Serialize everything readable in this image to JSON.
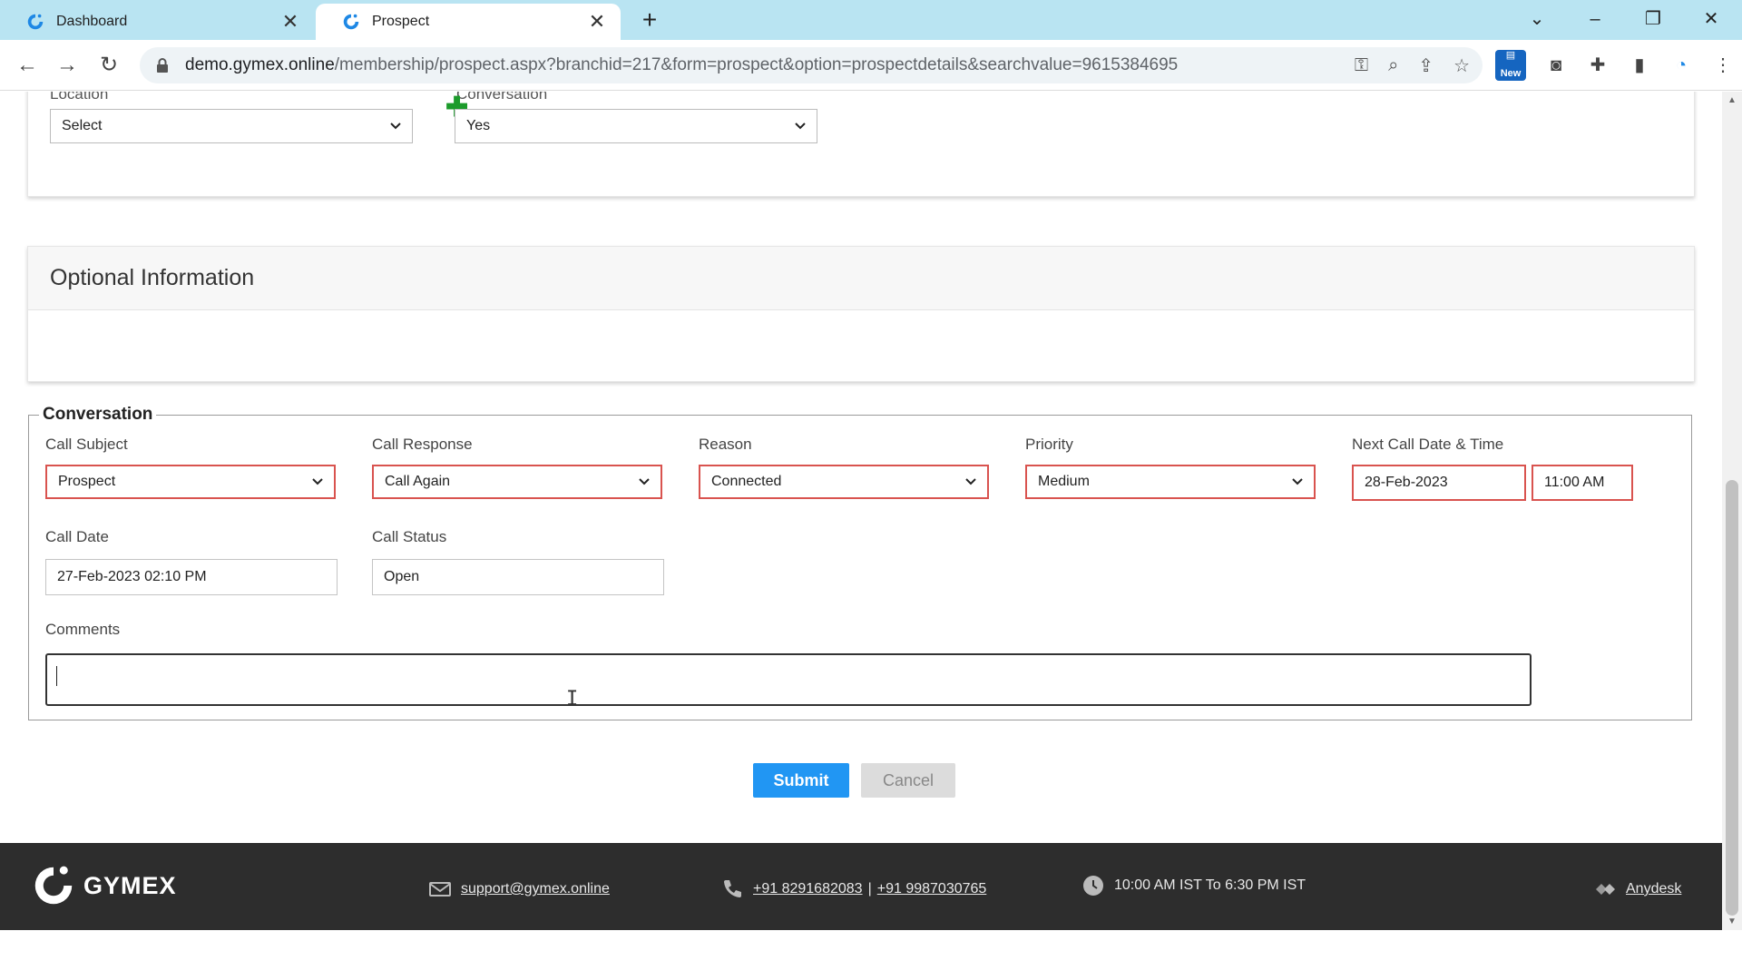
{
  "browser": {
    "tabs": [
      {
        "title": "Dashboard",
        "active": false
      },
      {
        "title": "Prospect",
        "active": true
      }
    ],
    "url_host": "demo.gymex.online",
    "url_path": "/membership/prospect.aspx?branchid=217&form=prospect&option=prospectdetails&searchvalue=9615384695"
  },
  "top_section": {
    "location_label": "Location",
    "location_value": "Select",
    "conversation_label": "Conversation",
    "conversation_value": "Yes"
  },
  "optional_section": {
    "title": "Optional Information"
  },
  "conversation": {
    "legend": "Conversation",
    "call_subject_label": "Call Subject",
    "call_subject_value": "Prospect",
    "call_response_label": "Call Response",
    "call_response_value": "Call Again",
    "reason_label": "Reason",
    "reason_value": "Connected",
    "priority_label": "Priority",
    "priority_value": "Medium",
    "next_call_label": "Next Call Date & Time",
    "next_call_date": "28-Feb-2023",
    "next_call_time": "11:00 AM",
    "call_date_label": "Call Date",
    "call_date_value": "27-Feb-2023 02:10 PM",
    "call_status_label": "Call Status",
    "call_status_value": "Open",
    "comments_label": "Comments",
    "comments_value": ""
  },
  "actions": {
    "submit_label": "Submit",
    "cancel_label": "Cancel"
  },
  "footer": {
    "brand": "GYMEX",
    "email": "support@gymex.online",
    "phone1": "+91 8291682083",
    "phone_sep": "|",
    "phone2": "+91 9987030765",
    "hours": "10:00 AM IST To 6:30 PM IST",
    "anydesk": "Anydesk"
  },
  "colors": {
    "tabstrip": "#b9e4f2",
    "submit": "#2196f3",
    "required_border": "#d9534f",
    "footer_bg": "#2d2d2d"
  }
}
